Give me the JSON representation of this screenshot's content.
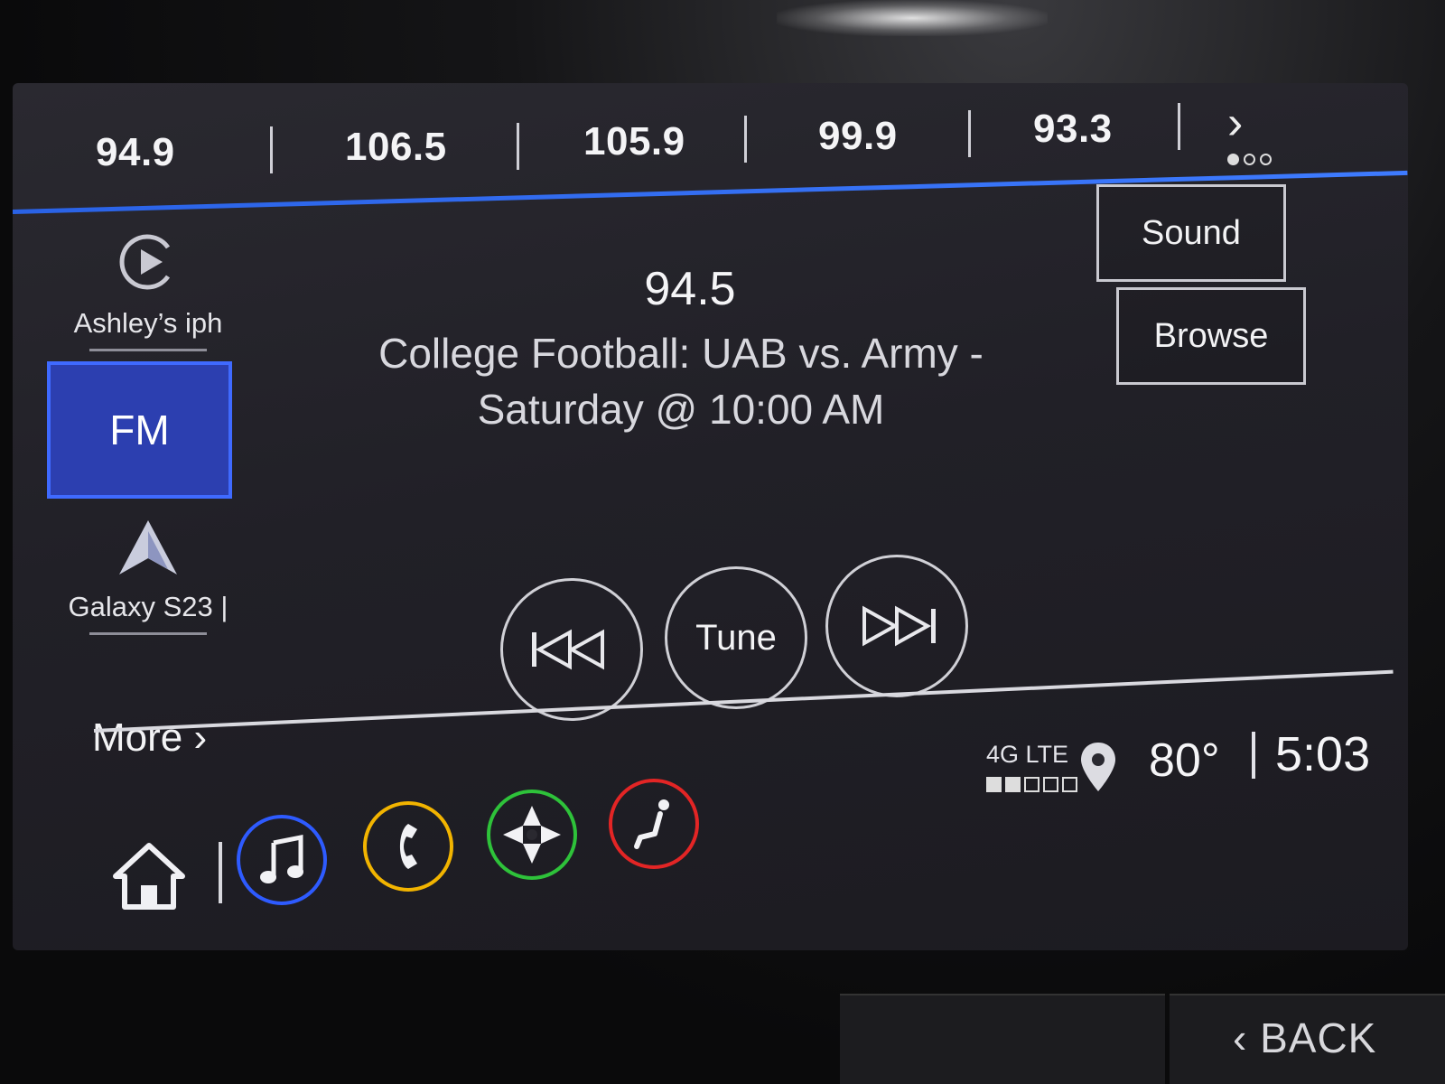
{
  "presets": [
    "94.9",
    "106.5",
    "105.9",
    "99.9",
    "93.3"
  ],
  "sources": {
    "phone1_label": "Ashley’s iph",
    "active_label": "FM",
    "phone2_label": "Galaxy S23 |",
    "more_label": "More ›"
  },
  "now_playing": {
    "frequency": "94.5",
    "line1": "College Football:  UAB vs. Army -",
    "line2": "Saturday @ 10:00 AM"
  },
  "buttons": {
    "sound": "Sound",
    "browse": "Browse",
    "tune": "Tune"
  },
  "status": {
    "network": "4G LTE",
    "signal_level": 2,
    "signal_max": 5,
    "temperature": "80°",
    "time": "5:03"
  },
  "nav_colors": {
    "audio": "#2e5bff",
    "phone": "#f2b400",
    "nav": "#2ec23a",
    "settings": "#e32525"
  },
  "hardware": {
    "back_label": "‹ BACK"
  },
  "icons": [
    "play-circle-icon",
    "android-auto-icon",
    "home-icon",
    "music-note-icon",
    "phone-icon",
    "compass-icon",
    "seat-icon",
    "seek-back-icon",
    "seek-forward-icon",
    "location-pin-icon",
    "chevron-right-icon"
  ]
}
